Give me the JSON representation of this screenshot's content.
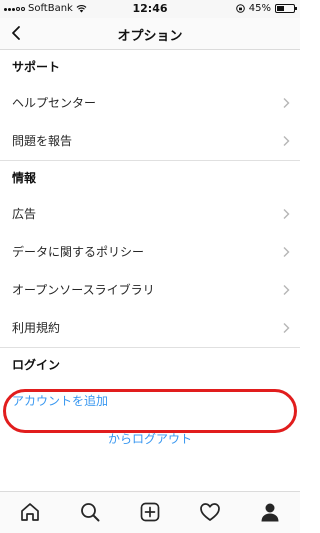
{
  "status_bar": {
    "carrier": "SoftBank",
    "time": "12:46",
    "battery_text": "45%",
    "battery_level": 0.45
  },
  "nav": {
    "title": "オプション",
    "back_icon": "chevron-left-icon"
  },
  "sections": {
    "support": {
      "header": "サポート",
      "items": [
        "ヘルプセンター",
        "問題を報告"
      ]
    },
    "info": {
      "header": "情報",
      "items": [
        "広告",
        "データに関するポリシー",
        "オープンソースライブラリ",
        "利用規約"
      ]
    },
    "login": {
      "header": "ログイン",
      "add_account": "アカウントを追加",
      "logout": "からログアウト"
    }
  },
  "tab_bar": {
    "icons": [
      "home-icon",
      "search-icon",
      "add-post-icon",
      "activity-heart-icon",
      "profile-icon"
    ]
  },
  "colors": {
    "accent": "#3897f0",
    "highlight": "#e11d1d",
    "divider": "#e0e0e0"
  }
}
